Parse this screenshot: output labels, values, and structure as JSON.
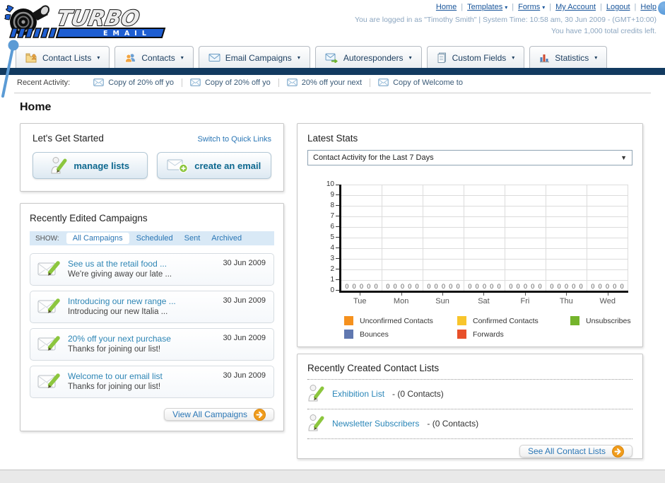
{
  "logo": {
    "title": "TURBO",
    "subtitle": "EMAIL"
  },
  "header": {
    "nav_links": [
      {
        "label": "Home",
        "dropdown": false
      },
      {
        "label": "Templates",
        "dropdown": true
      },
      {
        "label": "Forms",
        "dropdown": true
      },
      {
        "label": "My Account",
        "dropdown": false
      },
      {
        "label": "Logout",
        "dropdown": false
      },
      {
        "label": "Help",
        "dropdown": false
      }
    ],
    "login_line": "You are logged in as \"Timothy Smith\" | System Time: 10:58 am, 30 Jun 2009 - (GMT+10:00)",
    "credits_line": "You have 1,000 total credits left."
  },
  "brand_colors": {
    "navy_bar": "#123a60",
    "link_blue": "#17549a",
    "logo_blue": "#1e5ed2",
    "action_green": "#8cc63e",
    "arrow_orange": "#f09c1c"
  },
  "tabs": [
    {
      "label": "Contact Lists",
      "icon": "folder-user-icon"
    },
    {
      "label": "Contacts",
      "icon": "users-icon"
    },
    {
      "label": "Email Campaigns",
      "icon": "envelope-icon"
    },
    {
      "label": "Autoresponders",
      "icon": "envelope-arrow-icon"
    },
    {
      "label": "Custom Fields",
      "icon": "form-icon"
    },
    {
      "label": "Statistics",
      "icon": "bar-chart-icon"
    }
  ],
  "recent_activity": {
    "label": "Recent Activity:",
    "items": [
      "Copy of 20% off yo",
      "Copy of 20% off yo",
      "20% off your next",
      "Copy of Welcome to"
    ]
  },
  "page_title": "Home",
  "get_started": {
    "title": "Let's Get Started",
    "switch_link": "Switch to Quick Links",
    "buttons": [
      {
        "label": "manage lists",
        "icon": "person-pencil-icon"
      },
      {
        "label": "create an email",
        "icon": "create-email-icon"
      }
    ]
  },
  "campaigns": {
    "title": "Recently Edited Campaigns",
    "show_label": "SHOW:",
    "filters": [
      "All Campaigns",
      "Scheduled",
      "Sent",
      "Archived"
    ],
    "active_filter": "All Campaigns",
    "items": [
      {
        "title": "See us at the retail food ...",
        "subtitle": "We're giving away our late ...",
        "date": "30 Jun 2009"
      },
      {
        "title": "Introducing our new range ...",
        "subtitle": "Introducing our new Italia ...",
        "date": "30 Jun 2009"
      },
      {
        "title": "20% off your next purchase",
        "subtitle": "Thanks for joining our list!",
        "date": "30 Jun 2009"
      },
      {
        "title": "Welcome to our email list",
        "subtitle": "Thanks for joining our list!",
        "date": "30 Jun 2009"
      }
    ],
    "view_all_label": "View All Campaigns"
  },
  "stats": {
    "title": "Latest Stats",
    "dropdown_value": "Contact Activity for the Last 7 Days"
  },
  "chart_data": {
    "type": "bar",
    "title": "Contact Activity for the Last 7 Days",
    "categories": [
      "Tue",
      "Mon",
      "Sun",
      "Sat",
      "Fri",
      "Thu",
      "Wed"
    ],
    "series": [
      {
        "name": "Unconfirmed Contacts",
        "color": "#f5911e",
        "values": [
          0,
          0,
          0,
          0,
          0,
          0,
          0
        ]
      },
      {
        "name": "Confirmed Contacts",
        "color": "#f8c52c",
        "values": [
          0,
          0,
          0,
          0,
          0,
          0,
          0
        ]
      },
      {
        "name": "Unsubscribes",
        "color": "#74b42c",
        "values": [
          0,
          0,
          0,
          0,
          0,
          0,
          0
        ]
      },
      {
        "name": "Bounces",
        "color": "#6078b0",
        "values": [
          0,
          0,
          0,
          0,
          0,
          0,
          0
        ]
      },
      {
        "name": "Forwards",
        "color": "#e8502a",
        "values": [
          0,
          0,
          0,
          0,
          0,
          0,
          0
        ]
      }
    ],
    "ylim": [
      0,
      10
    ],
    "yticks": [
      0,
      1,
      2,
      3,
      4,
      5,
      6,
      7,
      8,
      9,
      10
    ],
    "grid": true,
    "legend_position": "bottom"
  },
  "contact_lists": {
    "title": "Recently Created Contact Lists",
    "items": [
      {
        "name": "Exhibition List",
        "count": "- (0 Contacts)"
      },
      {
        "name": "Newsletter Subscribers",
        "count": "- (0 Contacts)"
      }
    ],
    "see_all_label": "See All Contact Lists"
  }
}
